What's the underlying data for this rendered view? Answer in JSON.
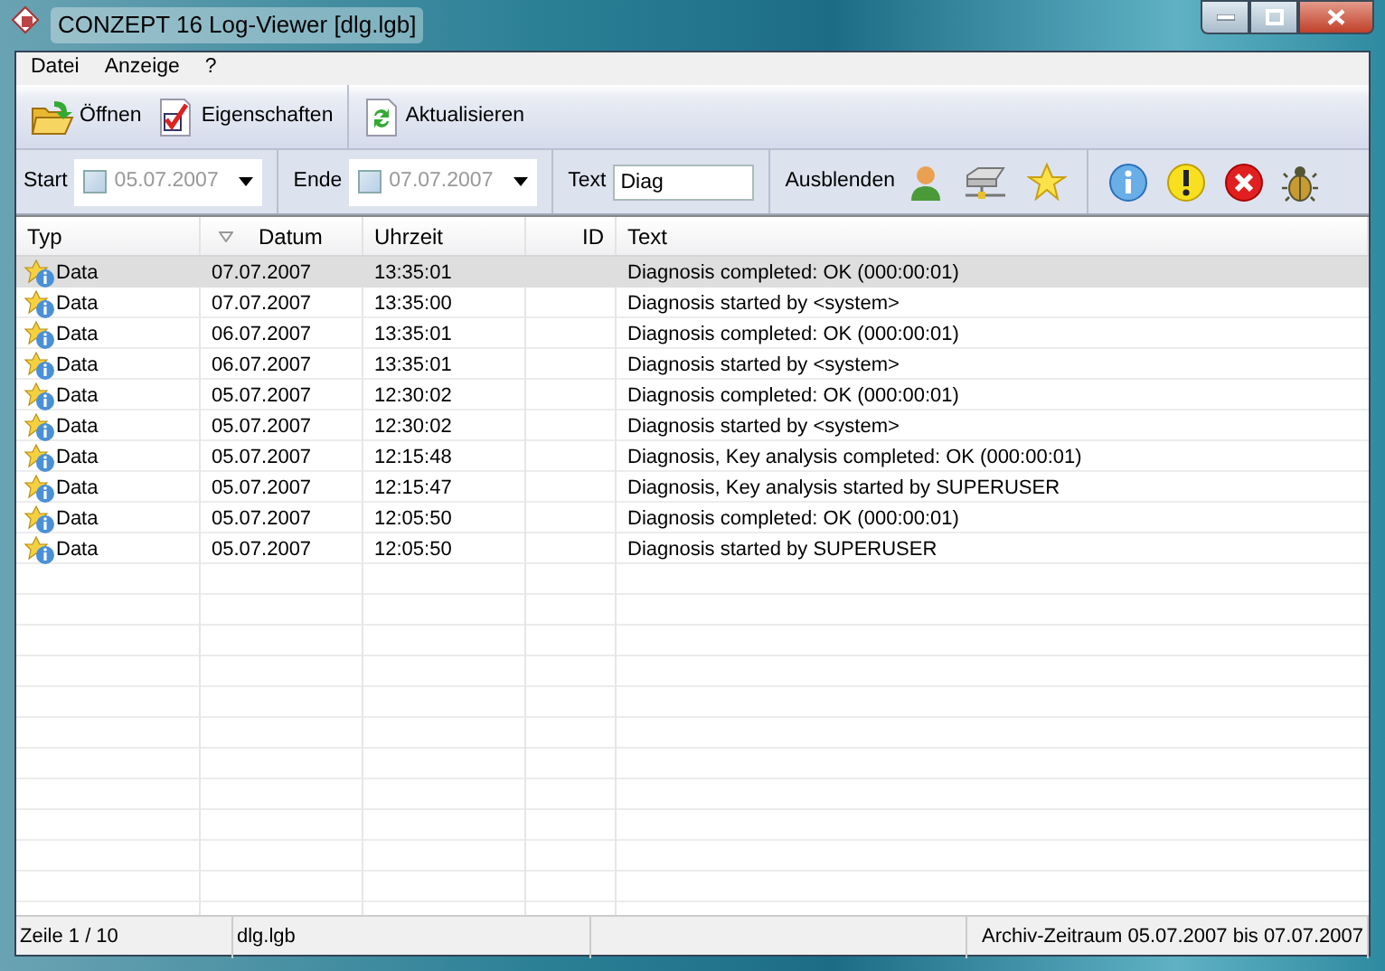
{
  "window": {
    "title": "CONZEPT 16 Log-Viewer [dlg.lgb]"
  },
  "menu": [
    "Datei",
    "Anzeige",
    "?"
  ],
  "toolbar": [
    {
      "label": "Öffnen",
      "kind": "open"
    },
    {
      "label": "Eigenschaften",
      "kind": "properties"
    },
    {
      "label": "Aktualisieren",
      "kind": "refresh"
    }
  ],
  "filter": {
    "start": {
      "label": "Start",
      "checked": false,
      "value": "05.07.2007"
    },
    "end": {
      "label": "Ende",
      "checked": false,
      "value": "07.07.2007"
    },
    "text": {
      "label": "Text",
      "value": "Diag"
    },
    "hide_label": "Ausblenden",
    "hide_icons": [
      {
        "kind": "user"
      },
      {
        "kind": "network"
      },
      {
        "kind": "star"
      },
      {
        "kind": "info"
      },
      {
        "kind": "warning"
      },
      {
        "kind": "error"
      },
      {
        "kind": "bug"
      }
    ]
  },
  "table": {
    "columns": [
      "Typ",
      "Datum",
      "Uhrzeit",
      "ID",
      "Text"
    ],
    "rows": [
      {
        "type": "Data",
        "date": "07.07.2007",
        "time": "13:35:01",
        "text": "Diagnosis completed: OK (000:00:01)",
        "selected": true
      },
      {
        "type": "Data",
        "date": "07.07.2007",
        "time": "13:35:00",
        "text": "Diagnosis started by <system>",
        "selected": false
      },
      {
        "type": "Data",
        "date": "06.07.2007",
        "time": "13:35:01",
        "text": "Diagnosis completed: OK (000:00:01)",
        "selected": false
      },
      {
        "type": "Data",
        "date": "06.07.2007",
        "time": "13:35:01",
        "text": "Diagnosis started by <system>",
        "selected": false
      },
      {
        "type": "Data",
        "date": "05.07.2007",
        "time": "12:30:02",
        "text": "Diagnosis completed: OK (000:00:01)",
        "selected": false
      },
      {
        "type": "Data",
        "date": "05.07.2007",
        "time": "12:30:02",
        "text": "Diagnosis started by <system>",
        "selected": false
      },
      {
        "type": "Data",
        "date": "05.07.2007",
        "time": "12:15:48",
        "text": "Diagnosis, Key analysis completed: OK (000:00:01)",
        "selected": false
      },
      {
        "type": "Data",
        "date": "05.07.2007",
        "time": "12:15:47",
        "text": "Diagnosis, Key analysis started by SUPERUSER",
        "selected": false
      },
      {
        "type": "Data",
        "date": "05.07.2007",
        "time": "12:05:50",
        "text": "Diagnosis completed: OK (000:00:01)",
        "selected": false
      },
      {
        "type": "Data",
        "date": "05.07.2007",
        "time": "12:05:50",
        "text": "Diagnosis started by SUPERUSER",
        "selected": false
      }
    ]
  },
  "status_bar": [
    "Zeile 1 / 10",
    "dlg.lgb",
    "Archiv-Zeitraum 05.07.2007 bis 07.07.2007"
  ]
}
